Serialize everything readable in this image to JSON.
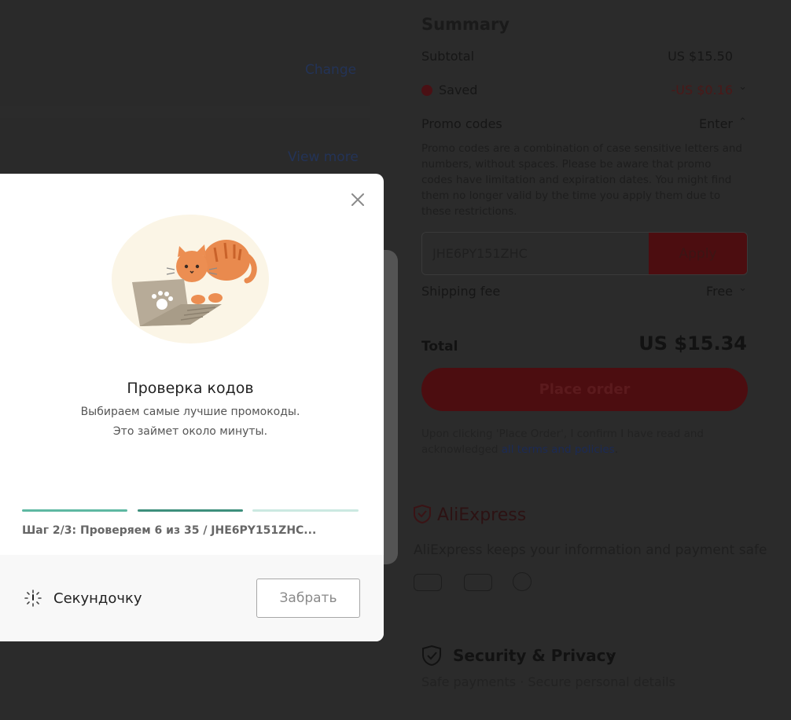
{
  "background": {
    "change_link": "Change",
    "view_more_link": "View more",
    "summary": {
      "title": "Summary",
      "subtotal_label": "Subtotal",
      "subtotal_value": "US $15.50",
      "saved_label": "Saved",
      "saved_value": "-US $0.16",
      "promo_label": "Promo codes",
      "promo_action": "Enter",
      "promo_description": "Promo codes are a combination of case sensitive letters and numbers, without spaces. Please be aware that promo codes have limitation and expiration dates. You might find them no longer valid by the time you apply them due to these restrictions.",
      "promo_input_value": "JHE6PY151ZHC",
      "apply_label": "Apply",
      "shipping_label": "Shipping fee",
      "shipping_value": "Free",
      "total_label": "Total",
      "total_value": "US $15.34",
      "place_order_label": "Place order",
      "terms_prefix": "Upon clicking 'Place Order', I confirm I have read and acknowledged ",
      "terms_link": "all terms and policies",
      "terms_suffix": "."
    },
    "brand": {
      "name": "AliExpress",
      "tagline": "AliExpress keeps your information and payment safe"
    },
    "security": {
      "title": "Security & Privacy",
      "subtitle": "Safe payments · Secure personal details"
    }
  },
  "modal": {
    "title": "Проверка кодов",
    "subtitle_line1": "Выбираем самые лучшие промокоды.",
    "subtitle_line2": "Это займет около минуты.",
    "step_text": "Шаг 2/3: Проверяем 6 из 35 / JHE6PY151ZHC...",
    "status_label": "Секундочку",
    "claim_button": "Забрать"
  },
  "colors": {
    "progress_done": "#5db8a2",
    "progress_active": "#3d8f7c",
    "progress_pending": "#cbe9e1"
  }
}
